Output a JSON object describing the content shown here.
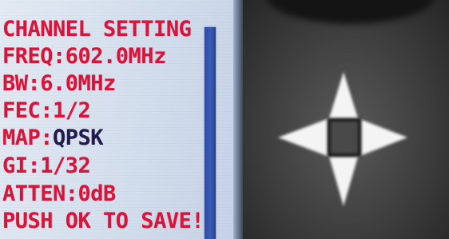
{
  "lcd": {
    "title": "CHANNEL SETTING",
    "freq": "FREQ:602.0MHz",
    "bw": "BW:6.0MHz",
    "fec": "FEC:1/2",
    "map_label": "MAP:",
    "map_value": "QPSK",
    "gi": "GI:1/32",
    "atten": "ATTEN:0dB",
    "footer": "PUSH OK TO SAVE!"
  },
  "colors": {
    "text": "#d8143a",
    "highlight_value": "#1d1d4d",
    "screen": "#d6e0ee",
    "scrollbar": "#3a5cb8"
  },
  "keypad": {
    "icon": "four-way-directional-pad-icon"
  }
}
